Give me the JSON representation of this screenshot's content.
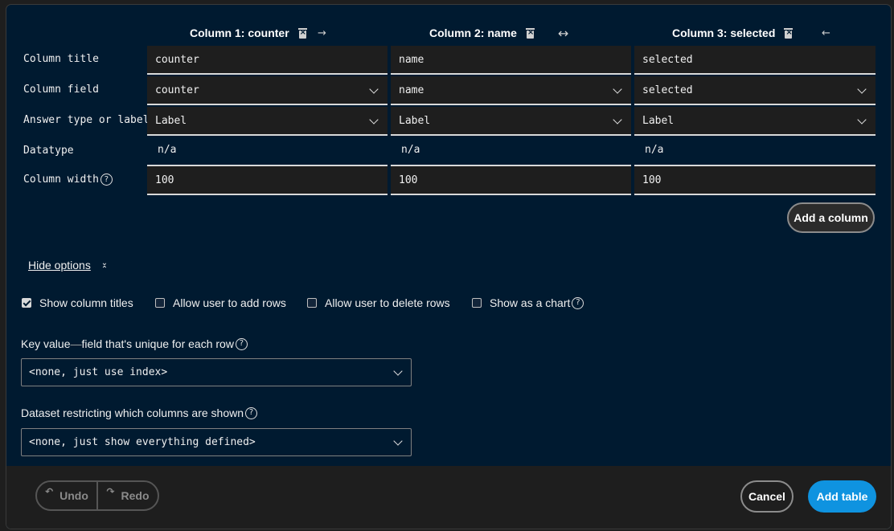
{
  "columns": [
    {
      "header": "Column 1: counter",
      "move_icon": "→",
      "title": "counter",
      "field": "counter",
      "answer_type": "Label",
      "datatype": "n/a",
      "width": "100"
    },
    {
      "header": "Column 2: name",
      "move_icon": "↔",
      "title": "name",
      "field": "name",
      "answer_type": "Label",
      "datatype": "n/a",
      "width": "100"
    },
    {
      "header": "Column 3: selected",
      "move_icon": "←",
      "title": "selected",
      "field": "selected",
      "answer_type": "Label",
      "datatype": "n/a",
      "width": "100"
    }
  ],
  "row_labels": {
    "title": "Column title",
    "field": "Column field",
    "answer_type": "Answer type or label",
    "datatype": "Datatype",
    "width": "Column width"
  },
  "add_column_label": "Add a column",
  "hide_options_label": "Hide options",
  "options": [
    {
      "label": "Show column titles",
      "checked": true
    },
    {
      "label": "Allow user to add rows",
      "checked": false
    },
    {
      "label": "Allow user to delete rows",
      "checked": false
    },
    {
      "label": "Show as a chart",
      "checked": false
    }
  ],
  "key_value": {
    "label_main": "Key value",
    "label_dash": " — ",
    "label_rest": "field that's unique for each row",
    "value": "<none, just use index>"
  },
  "dataset": {
    "label": "Dataset restricting which columns are shown",
    "value": "<none, just show everything defined>"
  },
  "footer": {
    "undo_label": "Undo",
    "redo_label": "Redo",
    "cancel_label": "Cancel",
    "add_table_label": "Add table"
  },
  "icons": {
    "help": "?",
    "undo": "↶",
    "redo": "↷",
    "collapse": "⌄⌃"
  },
  "colors": {
    "dialog_bg": "#001a30",
    "primary": "#0f93e0"
  }
}
